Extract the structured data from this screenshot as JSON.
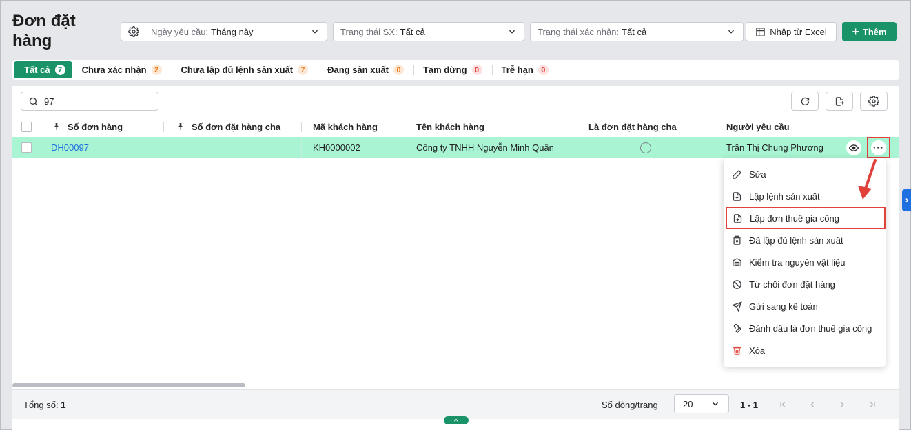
{
  "page": {
    "title": "Đơn đặt hàng"
  },
  "filters": {
    "date": {
      "label": "Ngày yêu cầu:",
      "value": "Tháng này"
    },
    "production": {
      "label": "Trạng thái SX:",
      "value": "Tất cả"
    },
    "confirm": {
      "label": "Trạng thái xác nhận:",
      "value": "Tất cả"
    }
  },
  "actions": {
    "import_label": "Nhập từ Excel",
    "add_label": "Thêm"
  },
  "tabs": [
    {
      "label": "Tất cả",
      "count": "7"
    },
    {
      "label": "Chưa xác nhận",
      "count": "2"
    },
    {
      "label": "Chưa lập đủ lệnh sản xuất",
      "count": "7"
    },
    {
      "label": "Đang sản xuất",
      "count": "0"
    },
    {
      "label": "Tạm dừng",
      "count": "0"
    },
    {
      "label": "Trễ hạn",
      "count": "0"
    }
  ],
  "search": {
    "value": "97"
  },
  "table": {
    "columns": [
      "Số đơn hàng",
      "Số đơn đặt hàng cha",
      "Mã khách hàng",
      "Tên khách hàng",
      "Là đơn đặt hàng cha",
      "Người yêu cầu"
    ],
    "rows": [
      {
        "order_no": "DH00097",
        "parent_order_no": "",
        "customer_code": "KH0000002",
        "customer_name": "Công ty TNHH Nguyễn Minh Quân",
        "is_parent": false,
        "requester": "Trần Thị Chung Phương"
      }
    ]
  },
  "context_menu": {
    "items": [
      {
        "label": "Sửa",
        "icon": "pencil-icon"
      },
      {
        "label": "Lập lệnh sản xuất",
        "icon": "file-plus-icon"
      },
      {
        "label": "Lập đơn thuê gia công",
        "icon": "file-plus-icon",
        "highlighted": true
      },
      {
        "label": "Đã lập đủ lệnh sản xuất",
        "icon": "clipboard-x-icon"
      },
      {
        "label": "Kiểm tra nguyên vật liệu",
        "icon": "warehouse-icon"
      },
      {
        "label": "Từ chối đơn đặt hàng",
        "icon": "ban-icon"
      },
      {
        "label": "Gửi sang kế toán",
        "icon": "send-icon"
      },
      {
        "label": "Đánh dấu là đơn thuê gia công",
        "icon": "wrench-icon"
      },
      {
        "label": "Xóa",
        "icon": "trash-icon"
      }
    ]
  },
  "footer": {
    "total_label": "Tổng số:",
    "total_value": "1",
    "rows_per_page_label": "Số dòng/trang",
    "rows_per_page": "20",
    "range": "1 - 1"
  },
  "colors": {
    "accent": "#1a9369",
    "row_highlight": "#a8f4d3",
    "link": "#1f6fe0",
    "annotation": "#e0413a"
  }
}
